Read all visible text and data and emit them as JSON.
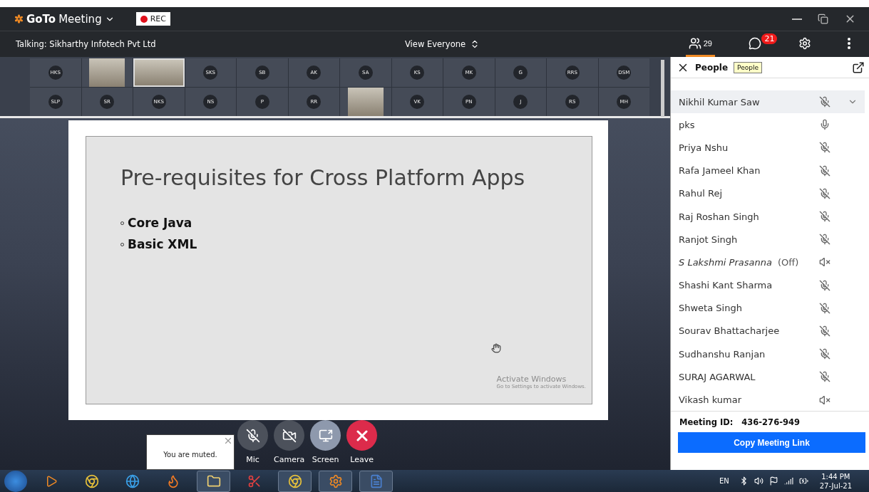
{
  "app": {
    "name_bold": "GoTo",
    "name_rest": "Meeting",
    "rec": "REC"
  },
  "subbar": {
    "talking": "Talking: Sikharthy Infotech Pvt Ltd",
    "view": "View Everyone"
  },
  "toolbar": {
    "people_count": "29",
    "chat_badge": "21",
    "people_selected": true
  },
  "tiles": [
    [
      {
        "kind": "initials",
        "label": "HKS"
      },
      {
        "kind": "video",
        "selected": false
      },
      {
        "kind": "video",
        "selected": true
      },
      {
        "kind": "initials",
        "label": "SKS"
      },
      {
        "kind": "initials",
        "label": "SB"
      },
      {
        "kind": "initials",
        "label": "AK"
      },
      {
        "kind": "initials",
        "label": "SA"
      },
      {
        "kind": "initials",
        "label": "KS"
      },
      {
        "kind": "initials",
        "label": "MK"
      },
      {
        "kind": "initials",
        "label": "G"
      },
      {
        "kind": "initials",
        "label": "RRS"
      },
      {
        "kind": "initials",
        "label": "DSM"
      }
    ],
    [
      {
        "kind": "initials",
        "label": "SLP"
      },
      {
        "kind": "initials",
        "label": "SR"
      },
      {
        "kind": "initials",
        "label": "NKS"
      },
      {
        "kind": "initials",
        "label": "NS"
      },
      {
        "kind": "initials",
        "label": "P"
      },
      {
        "kind": "initials",
        "label": "RR"
      },
      {
        "kind": "video",
        "selected": false
      },
      {
        "kind": "initials",
        "label": "VK"
      },
      {
        "kind": "initials",
        "label": "PN"
      },
      {
        "kind": "initials",
        "label": "J"
      },
      {
        "kind": "initials",
        "label": "RS"
      },
      {
        "kind": "initials",
        "label": "MH"
      }
    ]
  ],
  "slide": {
    "title": "Pre-requisites for Cross Platform Apps",
    "bullets": [
      "Core Java",
      "Basic XML"
    ],
    "activate_title": "Activate Windows",
    "activate_hint": "Go to Settings to activate Windows."
  },
  "toast": {
    "text": "You are muted."
  },
  "controls": [
    {
      "kind": "mic",
      "label": "Mic"
    },
    {
      "kind": "camera",
      "label": "Camera"
    },
    {
      "kind": "screen",
      "label": "Screen"
    },
    {
      "kind": "leave",
      "label": "Leave"
    }
  ],
  "people_panel": {
    "title": "People",
    "tooltip": "People",
    "meeting_id_label": "Meeting ID:",
    "meeting_id": "436-276-949",
    "copy_button": "Copy Meeting Link",
    "people": [
      {
        "name": "Nikhil Kumar Saw",
        "kind": "muted",
        "selected": true
      },
      {
        "name": "pks",
        "kind": "mic",
        "selected": false
      },
      {
        "name": "Priya Nshu",
        "kind": "muted",
        "selected": false
      },
      {
        "name": "Rafa Jameel Khan",
        "kind": "muted",
        "selected": false
      },
      {
        "name": "Rahul Rej",
        "kind": "muted",
        "selected": false
      },
      {
        "name": "Raj Roshan Singh",
        "kind": "muted",
        "selected": false
      },
      {
        "name": "Ranjot Singh",
        "kind": "muted",
        "selected": false
      },
      {
        "name": "S Lakshmi Prasanna",
        "status": "(Off)",
        "kind": "audio_off",
        "selected": false
      },
      {
        "name": "Shashi Kant Sharma",
        "kind": "muted",
        "selected": false
      },
      {
        "name": "Shweta Singh",
        "kind": "muted",
        "selected": false
      },
      {
        "name": "Sourav Bhattacharjee",
        "kind": "muted",
        "selected": false
      },
      {
        "name": "Sudhanshu Ranjan",
        "kind": "muted",
        "selected": false
      },
      {
        "name": "SURAJ AGARWAL",
        "kind": "muted",
        "selected": false
      },
      {
        "name": "Vikash kumar",
        "kind": "audio_off",
        "selected": false
      }
    ]
  },
  "taskbar": {
    "language": "EN",
    "time": "1:44 PM",
    "date": "27-Jul-21"
  }
}
